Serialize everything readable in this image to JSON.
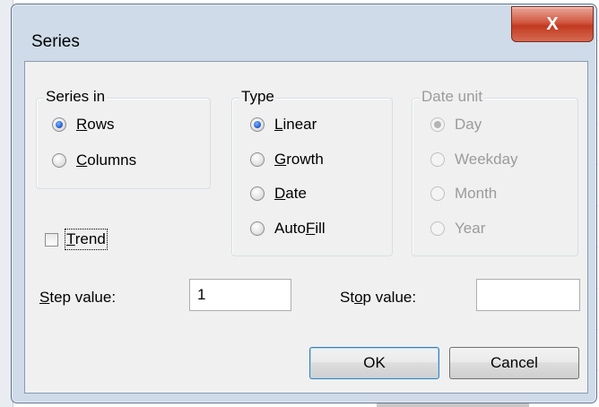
{
  "dialog": {
    "title": "Series",
    "close_glyph": "X"
  },
  "series_in": {
    "label": "Series in",
    "options": [
      {
        "pre": "",
        "acc": "R",
        "post": "ows",
        "checked": true
      },
      {
        "pre": "",
        "acc": "C",
        "post": "olumns",
        "checked": false
      }
    ]
  },
  "type": {
    "label": "Type",
    "options": [
      {
        "pre": "",
        "acc": "L",
        "post": "inear",
        "checked": true
      },
      {
        "pre": "",
        "acc": "G",
        "post": "rowth",
        "checked": false
      },
      {
        "pre": "",
        "acc": "D",
        "post": "ate",
        "checked": false
      },
      {
        "pre": "Auto",
        "acc": "F",
        "post": "ill",
        "checked": false
      }
    ]
  },
  "date_unit": {
    "label": "Date unit",
    "options": [
      {
        "text": "Day",
        "checked": true
      },
      {
        "text": "Weekday",
        "checked": false
      },
      {
        "text": "Month",
        "checked": false
      },
      {
        "text": "Year",
        "checked": false
      }
    ]
  },
  "trend": {
    "pre": "",
    "acc": "T",
    "post": "rend",
    "checked": false
  },
  "step": {
    "label_acc": "S",
    "label_post": "tep value:",
    "value": "1"
  },
  "stop": {
    "label_pre": "St",
    "label_acc": "o",
    "label_post": "p value:",
    "value": ""
  },
  "buttons": {
    "ok": "OK",
    "cancel": "Cancel"
  },
  "colors": {
    "close_button": "#c13a20",
    "frame": "#cfdbe8",
    "radio_selected": "#1d58c7"
  }
}
